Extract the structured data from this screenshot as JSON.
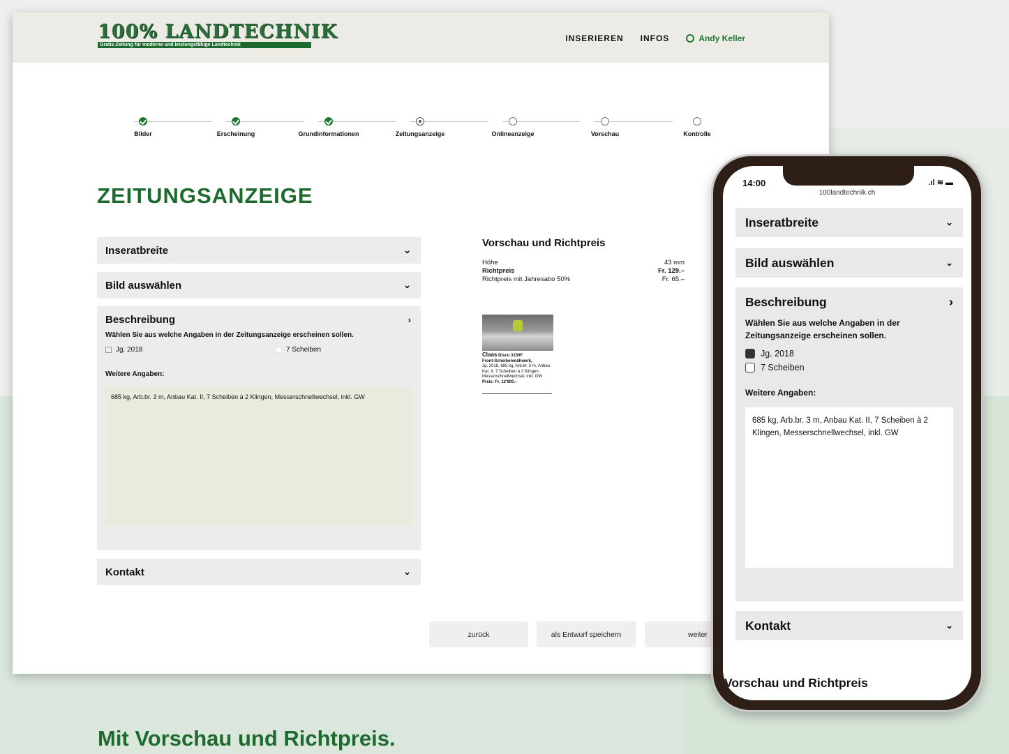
{
  "header": {
    "logo_title": "100% LANDTECHNIK",
    "logo_subtitle": "Gratis-Zeitung für moderne und leistungsfähige Landtechnik",
    "nav_inserieren": "INSERIEREN",
    "nav_infos": "INFOS",
    "user_name": "Andy Keller"
  },
  "stepper": [
    {
      "label": "Bilder",
      "state": "done"
    },
    {
      "label": "Erscheinung",
      "state": "done"
    },
    {
      "label": "Grundinformationen",
      "state": "done"
    },
    {
      "label": "Zeitungsanzeige",
      "state": "current"
    },
    {
      "label": "Onlineanzeige",
      "state": "todo"
    },
    {
      "label": "Vorschau",
      "state": "todo"
    },
    {
      "label": "Kontrolle",
      "state": "todo"
    }
  ],
  "page_title": "ZEITUNGSANZEIGE",
  "accordion": {
    "inseratbreite": "Inseratbreite",
    "bild": "Bild auswählen",
    "beschreibung": "Beschreibung",
    "hint": "Wählen Sie aus welche Angaben in der Zeitungsanzeige erscheinen sollen.",
    "check1": "Jg. 2018",
    "check2": "7 Scheiben",
    "further_label": "Weitere Angaben:",
    "further_text": "685 kg, Arb.br. 3 m, Anbau Kat. II, 7 Scheiben à 2 Klingen, Messerschnellwechsel, inkl. GW",
    "kontakt": "Kontakt"
  },
  "preview": {
    "title": "Vorschau und Richtpreis",
    "rows": [
      {
        "label": "Höhe",
        "value": "43 mm"
      },
      {
        "label": "Richtpreis",
        "value": "Fr. 129.–"
      },
      {
        "label": "Richtpreis mit Jahresabo 50%",
        "value": "Fr. 65.–"
      }
    ],
    "ad_brand": "Claas",
    "ad_model": "Disco 3150F",
    "ad_line1": "Front-Scheibenmähwerk,",
    "ad_line2": "Jg. 2018, 685 kg, Arb.br. 3 m, Anbau Kat. II, 7 Scheiben à 2 Klingen, Messerschnellwechsel, inkl. GW",
    "ad_price": "Preis: Fr. 12'900.–"
  },
  "buttons": {
    "back": "zurück",
    "draft": "als Entwurf speichern",
    "next": "weiter"
  },
  "caption": "Mit Vorschau und Richtpreis.",
  "mobile": {
    "time": "14:00",
    "url": "100landtechnik.ch",
    "inseratbreite": "Inseratbreite",
    "bild": "Bild auswählen",
    "beschreibung": "Beschreibung",
    "hint": "Wählen Sie aus welche Angaben in der Zeitungsanzeige erscheinen sollen.",
    "check1": "Jg. 2018",
    "check2": "7 Scheiben",
    "further_label": "Weitere Angaben:",
    "further_text": "685 kg, Arb.br. 3 m, Anbau Kat. II, 7 Scheiben à 2 Klingen, Messerschnellwechsel, inkl. GW",
    "kontakt": "Kontakt",
    "preview_title": "Vorschau und Richtpreis"
  }
}
